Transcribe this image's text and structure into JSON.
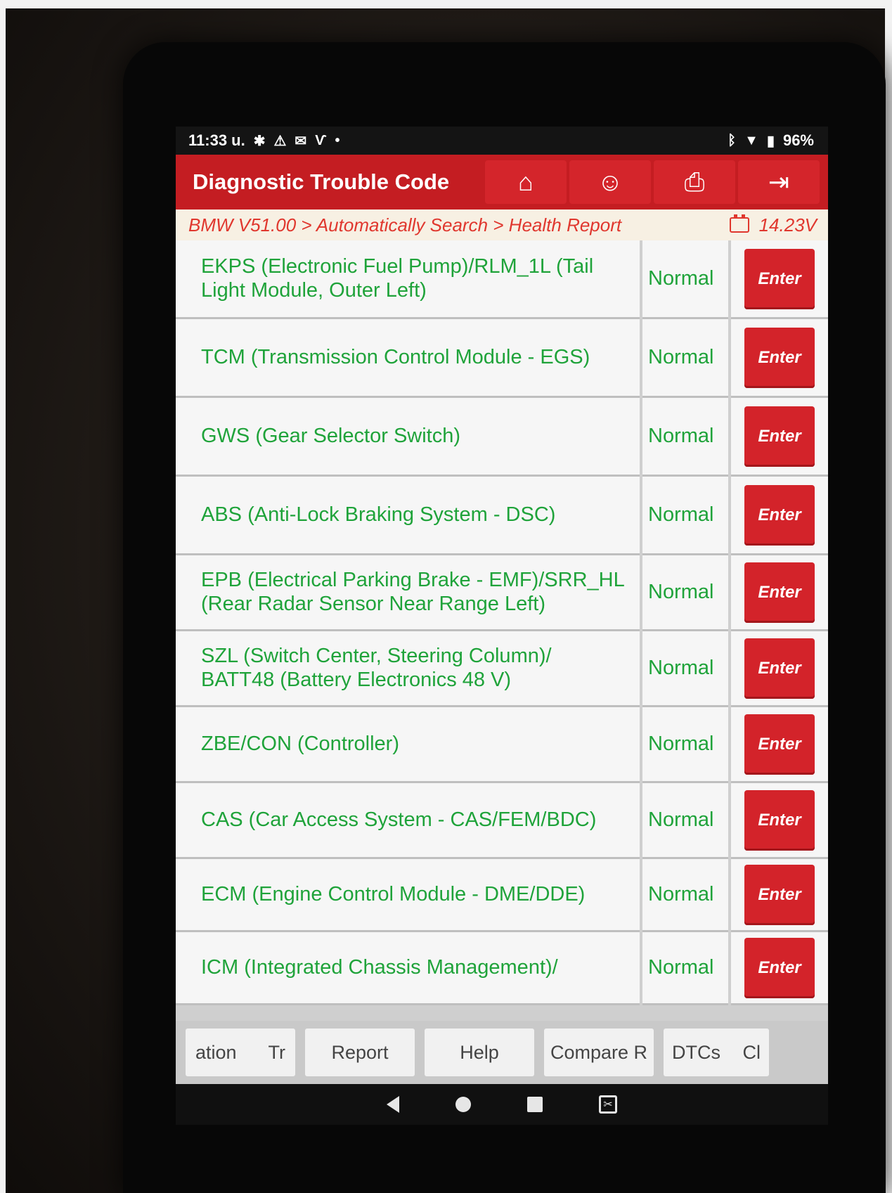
{
  "status_bar": {
    "time": "11:33 u.",
    "left_icons": [
      "gear-icon",
      "triangle-warning-icon",
      "gmail-icon",
      "vci-icon",
      "dot-icon"
    ],
    "battery": "96%"
  },
  "header": {
    "title": "Diagnostic Trouble Code",
    "buttons": [
      {
        "icon": "home-icon",
        "glyph": "⌂"
      },
      {
        "icon": "support-person-icon",
        "glyph": "☺"
      },
      {
        "icon": "print-icon",
        "glyph": "⎙"
      },
      {
        "icon": "exit-icon",
        "glyph": "⇥"
      }
    ]
  },
  "breadcrumb": {
    "path": "BMW V51.00 > Automatically Search > Health Report",
    "voltage": "14.23V"
  },
  "modules": [
    {
      "name": "EKPS (Electronic Fuel Pump)/RLM_1L (Tail Light Module, Outer Left)",
      "status": "Normal",
      "action": "Enter"
    },
    {
      "name": "TCM (Transmission Control Module - EGS)",
      "status": "Normal",
      "action": "Enter"
    },
    {
      "name": "GWS (Gear Selector Switch)",
      "status": "Normal",
      "action": "Enter"
    },
    {
      "name": "ABS (Anti-Lock Braking System - DSC)",
      "status": "Normal",
      "action": "Enter"
    },
    {
      "name": "EPB (Electrical Parking Brake - EMF)/SRR_HL (Rear Radar Sensor Near Range Left)",
      "status": "Normal",
      "action": "Enter"
    },
    {
      "name": "SZL (Switch Center, Steering Column)/ BATT48 (Battery Electronics 48 V)",
      "status": "Normal",
      "action": "Enter"
    },
    {
      "name": "ZBE/CON (Controller)",
      "status": "Normal",
      "action": "Enter"
    },
    {
      "name": "CAS (Car Access System - CAS/FEM/BDC)",
      "status": "Normal",
      "action": "Enter"
    },
    {
      "name": "ECM (Engine Control Module - DME/DDE)",
      "status": "Normal",
      "action": "Enter"
    },
    {
      "name": "ICM (Integrated Chassis Management)/",
      "status": "Normal",
      "action": "Enter"
    }
  ],
  "toolbar": {
    "btn1_a": "ation",
    "btn1_b": "Tr",
    "report": "Report",
    "help": "Help",
    "compare": "Compare R",
    "btn5_a": "DTCs",
    "btn5_b": "Cl"
  },
  "colors": {
    "accent_red": "#c41d22",
    "status_green": "#1fa33a",
    "breadcrumb_red": "#e0372e"
  }
}
